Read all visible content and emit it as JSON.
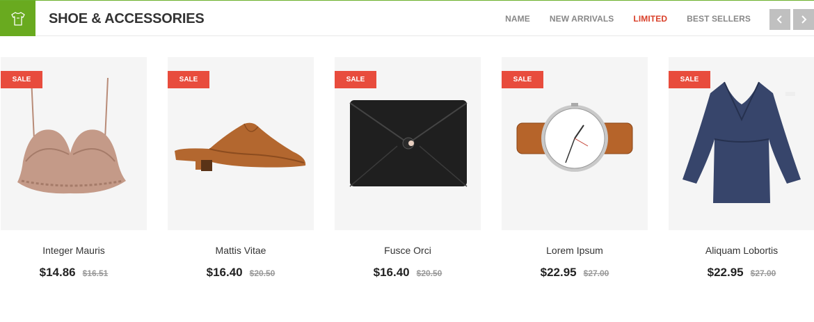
{
  "header": {
    "title": "SHOE & ACCESSORIES",
    "icon": "shirt-icon",
    "accent_color": "#69aa1f"
  },
  "tabs": [
    {
      "label": "NAME",
      "active": false
    },
    {
      "label": "NEW ARRIVALS",
      "active": false
    },
    {
      "label": "LIMITED",
      "active": true
    },
    {
      "label": "BEST SELLERS",
      "active": false
    }
  ],
  "nav": {
    "prev_icon": "chevron-left-icon",
    "next_icon": "chevron-right-icon"
  },
  "products": [
    {
      "name": "Integer Mauris",
      "price": "$14.86",
      "old_price": "$16.51",
      "badge": "SALE",
      "image": "lace-bralette"
    },
    {
      "name": "Mattis Vitae",
      "price": "$16.40",
      "old_price": "$20.50",
      "badge": "SALE",
      "image": "leather-mule"
    },
    {
      "name": "Fusce Orci",
      "price": "$16.40",
      "old_price": "$20.50",
      "badge": "SALE",
      "image": "black-envelope-clutch"
    },
    {
      "name": "Lorem Ipsum",
      "price": "$22.95",
      "old_price": "$27.00",
      "badge": "SALE",
      "image": "leather-strap-watch"
    },
    {
      "name": "Aliquam Lobortis",
      "price": "$22.95",
      "old_price": "$27.00",
      "badge": "SALE",
      "image": "denim-dress"
    }
  ],
  "colors": {
    "sale": "#e84c3d",
    "active_tab": "#d9402a",
    "nav_button": "#c0c0c0"
  }
}
